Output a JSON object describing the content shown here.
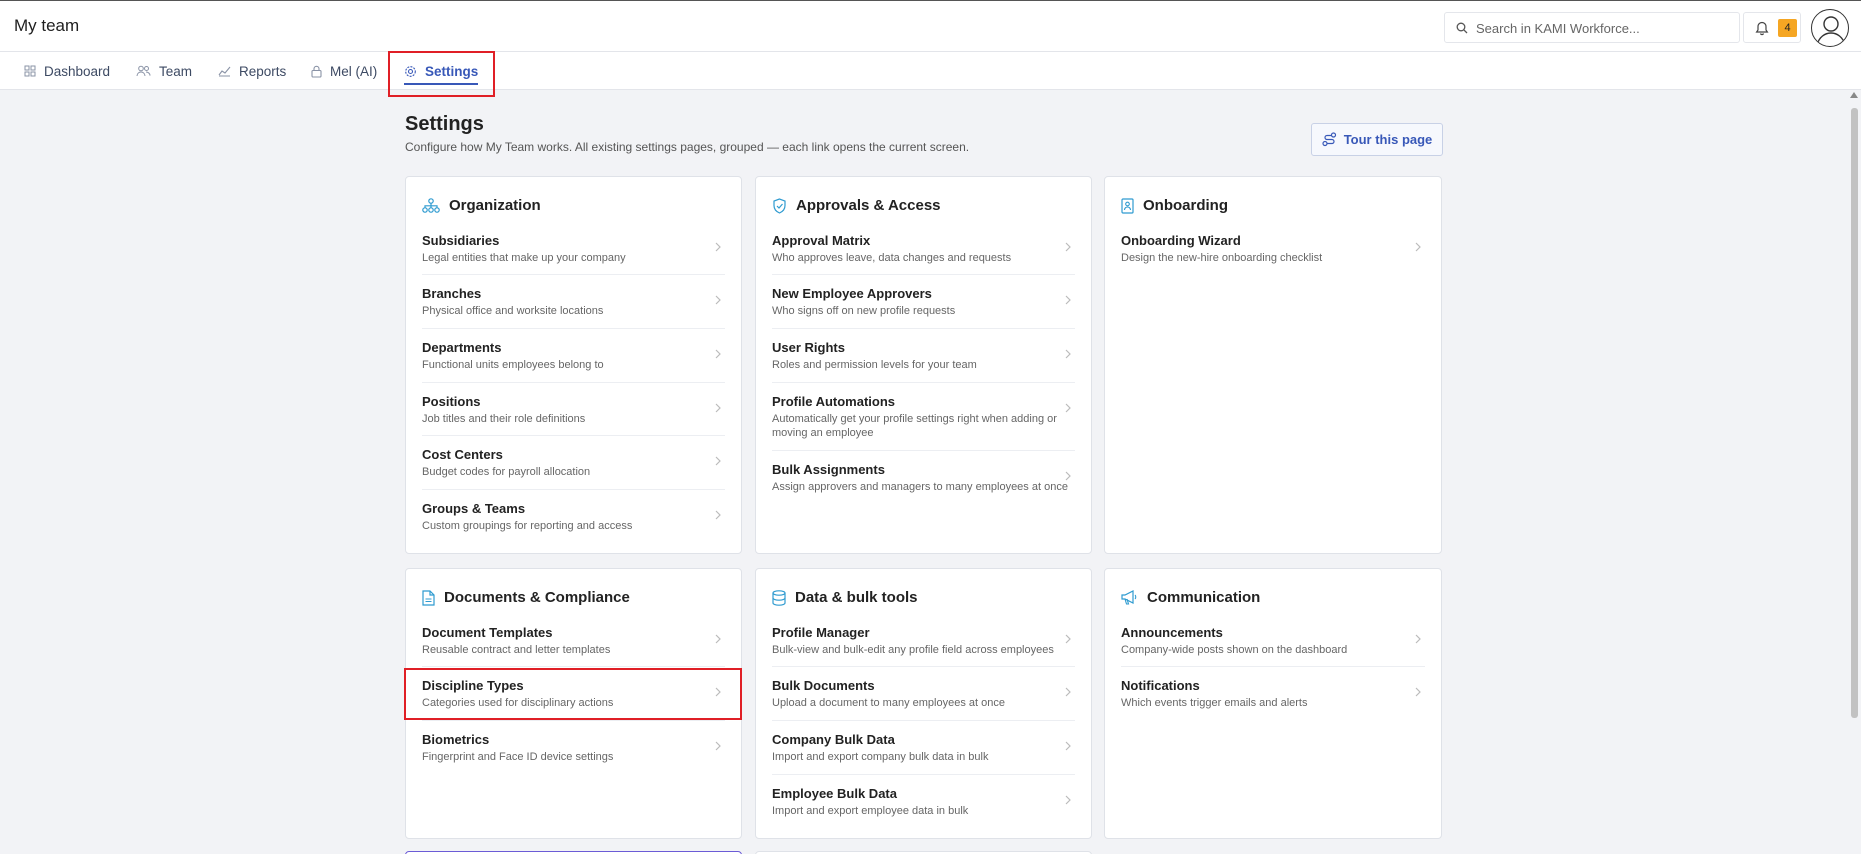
{
  "app_title": "My team",
  "search": {
    "placeholder": "Search in KAMI Workforce..."
  },
  "notifications": {
    "count": "4"
  },
  "nav": {
    "tabs": [
      {
        "label": "Dashboard"
      },
      {
        "label": "Team"
      },
      {
        "label": "Reports"
      },
      {
        "label": "Mel (AI)"
      },
      {
        "label": "Settings"
      }
    ]
  },
  "page": {
    "title": "Settings",
    "subtitle": "Configure how My Team works. All existing settings pages, grouped — each link opens the current screen.",
    "tour_label": "Tour this page"
  },
  "colors": {
    "accent": "#3858b8",
    "highlight": "#e01f26",
    "badge": "#f5a623"
  },
  "cards": [
    {
      "title": "Organization",
      "icon": "org-chart-icon",
      "items": [
        {
          "title": "Subsidiaries",
          "desc": "Legal entities that make up your company"
        },
        {
          "title": "Branches",
          "desc": "Physical office and worksite locations"
        },
        {
          "title": "Departments",
          "desc": "Functional units employees belong to"
        },
        {
          "title": "Positions",
          "desc": "Job titles and their role definitions"
        },
        {
          "title": "Cost Centers",
          "desc": "Budget codes for payroll allocation"
        },
        {
          "title": "Groups & Teams",
          "desc": "Custom groupings for reporting and access"
        }
      ]
    },
    {
      "title": "Approvals & Access",
      "icon": "shield-check-icon",
      "items": [
        {
          "title": "Approval Matrix",
          "desc": "Who approves leave, data changes and requests"
        },
        {
          "title": "New Employee Approvers",
          "desc": "Who signs off on new profile requests"
        },
        {
          "title": "User Rights",
          "desc": "Roles and permission levels for your team"
        },
        {
          "title": "Profile Automations",
          "desc": "Automatically get your profile settings right when adding or moving an employee"
        },
        {
          "title": "Bulk Assignments",
          "desc": "Assign approvers and managers to many employees at once"
        }
      ]
    },
    {
      "title": "Onboarding",
      "icon": "id-badge-icon",
      "items": [
        {
          "title": "Onboarding Wizard",
          "desc": "Design the new-hire onboarding checklist"
        }
      ]
    },
    {
      "title": "Documents & Compliance",
      "icon": "document-icon",
      "items": [
        {
          "title": "Document Templates",
          "desc": "Reusable contract and letter templates"
        },
        {
          "title": "Discipline Types",
          "desc": "Categories used for disciplinary actions"
        },
        {
          "title": "Biometrics",
          "desc": "Fingerprint and Face ID device settings"
        }
      ]
    },
    {
      "title": "Data & bulk tools",
      "icon": "database-icon",
      "items": [
        {
          "title": "Profile Manager",
          "desc": "Bulk-view and bulk-edit any profile field across employees"
        },
        {
          "title": "Bulk Documents",
          "desc": "Upload a document to many employees at once"
        },
        {
          "title": "Company Bulk Data",
          "desc": "Import and export company bulk data in bulk"
        },
        {
          "title": "Employee Bulk Data",
          "desc": "Import and export employee data in bulk"
        }
      ]
    },
    {
      "title": "Communication",
      "icon": "megaphone-icon",
      "items": [
        {
          "title": "Announcements",
          "desc": "Company-wide posts shown on the dashboard"
        },
        {
          "title": "Notifications",
          "desc": "Which events trigger emails and alerts"
        }
      ]
    }
  ]
}
